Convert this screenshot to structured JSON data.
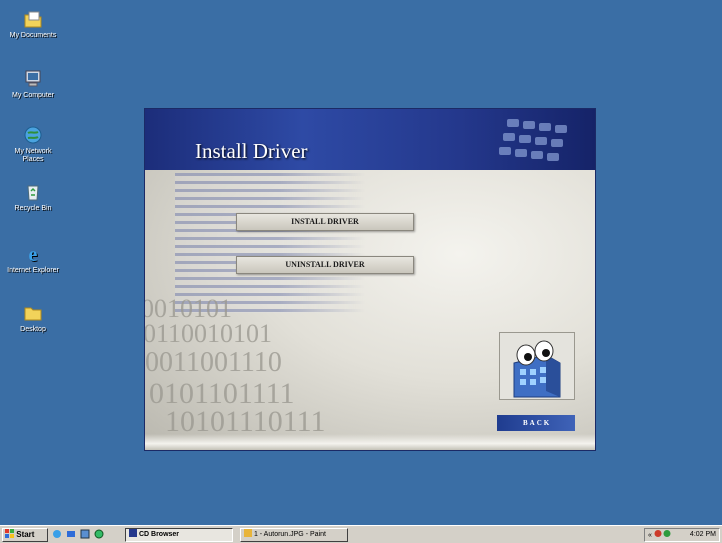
{
  "desktop": {
    "icons": [
      {
        "label": "My Documents"
      },
      {
        "label": "My Computer"
      },
      {
        "label": "My Network Places"
      },
      {
        "label": "Recycle Bin"
      },
      {
        "label": "Internet Explorer"
      },
      {
        "label": "Desktop"
      }
    ]
  },
  "installer": {
    "title": "Install Driver",
    "install_button": "INSTALL  DRIVER",
    "uninstall_button": "UNINSTALL DRIVER",
    "back_button": "BACK",
    "binary_lines": [
      "0010101",
      "0110010101",
      "0011001110",
      "0101101111",
      "10101110111"
    ]
  },
  "taskbar": {
    "start_label": "Start",
    "tasks": [
      {
        "label": "CD Browser",
        "active": true
      },
      {
        "label": "1 - Autorun.JPG - Paint",
        "active": false
      }
    ],
    "tray": {
      "chevron": "«",
      "clock": "4:02 PM"
    }
  },
  "colors": {
    "desktop": "#3a6ea5",
    "banner": "#24388c",
    "taskbar": "#d4d0c8"
  }
}
